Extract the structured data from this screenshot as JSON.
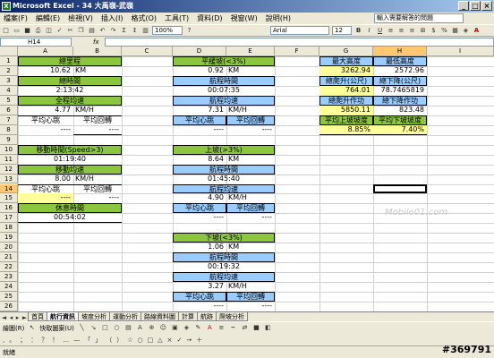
{
  "window": {
    "title": "Microsoft Excel - 34 大禹嶺-武嶺",
    "app_icon": "X",
    "buttons": [
      "_",
      "□",
      "×"
    ]
  },
  "menu": [
    "檔案(F)",
    "編輯(E)",
    "檢視(V)",
    "插入(I)",
    "格式(O)",
    "工具(T)",
    "資料(D)",
    "視窗(W)",
    "說明(H)"
  ],
  "help_box": "輸入需要解答的問題",
  "toolbar": {
    "zoom": "100%",
    "font": "Arial",
    "font_size": "12"
  },
  "formula": {
    "name_box": "H14",
    "fx": "fx",
    "value": ""
  },
  "columns": [
    "A",
    "B",
    "C",
    "D",
    "E",
    "F",
    "G",
    "H",
    "I"
  ],
  "rows": [
    "1",
    "2",
    "3",
    "4",
    "5",
    "6",
    "7",
    "8",
    "9",
    "10",
    "11",
    "12",
    "13",
    "14",
    "15",
    "16",
    "17",
    "18",
    "19",
    "20",
    "21",
    "22",
    "23",
    "24",
    "25",
    "26"
  ],
  "selected": {
    "column": "H",
    "row": "14"
  },
  "sheet": {
    "total_distance_label": "總里程",
    "total_distance": "10.62",
    "km": "KM",
    "total_time_label": "總時間",
    "total_time": "2:13:42",
    "total_avg_speed_label": "全程均速",
    "total_avg_speed": "4.77",
    "kmh": "KM/H",
    "avg_hr_label": "平均心跳",
    "avg_cadence_label": "平均回轉",
    "dash": "----",
    "moving_time_label": "移動時間(Speed>3)",
    "moving_time": "01:19:40",
    "moving_avg_label": "移動均速",
    "moving_avg": "8.00",
    "rest_time_label": "休息時間",
    "rest_time": "00:54:02",
    "flat_label": "平緩坡(<3%)",
    "flat_distance": "0.92",
    "flat_time_label": "航程時間",
    "flat_time": "00:07:35",
    "flat_avg_label": "航程均速",
    "flat_avg": "7.31",
    "up_label": "上坡(>3%)",
    "up_distance": "8.64",
    "up_time": "01:45:40",
    "up_avg": "4.90",
    "down_label": "下坡(<3%)",
    "down_distance": "1.06",
    "down_time": "00:19:32",
    "down_avg": "3.27",
    "max_alt_label": "最大高度",
    "max_alt": "3262.94",
    "min_alt_label": "最低高度",
    "min_alt": "2572.96",
    "total_climb_label": "總爬升(公尺)",
    "total_climb": "764.01",
    "total_descent_label": "總下降(公尺)",
    "total_descent": "78.7465819",
    "climb_work_label": "總爬升作功",
    "climb_work": "5850.11",
    "descent_work_label": "總下降作功",
    "descent_work": "823.48",
    "avg_up_grade_label": "平均上坡坡度",
    "avg_up_grade": "8.85%",
    "avg_down_grade_label": "平均下坡坡度",
    "avg_down_grade": "7.40%"
  },
  "tabs": [
    "首頁",
    "航行資訊",
    "坡度分析",
    "運動分析",
    "路線資料圖",
    "計算",
    "航跡",
    "爬坡分析"
  ],
  "active_tab": "航行資訊",
  "drawbar": {
    "draw_label": "繪圖(R)",
    "autoshape_label": "快取圖案(U)"
  },
  "status": "就緒",
  "watermark": "#369791",
  "faint_mark": "Mobile01.com",
  "colors": {
    "green": "#8cc63f",
    "blue": "#99ccff",
    "yellow": "#ffff99",
    "selection": "#ffc870"
  }
}
